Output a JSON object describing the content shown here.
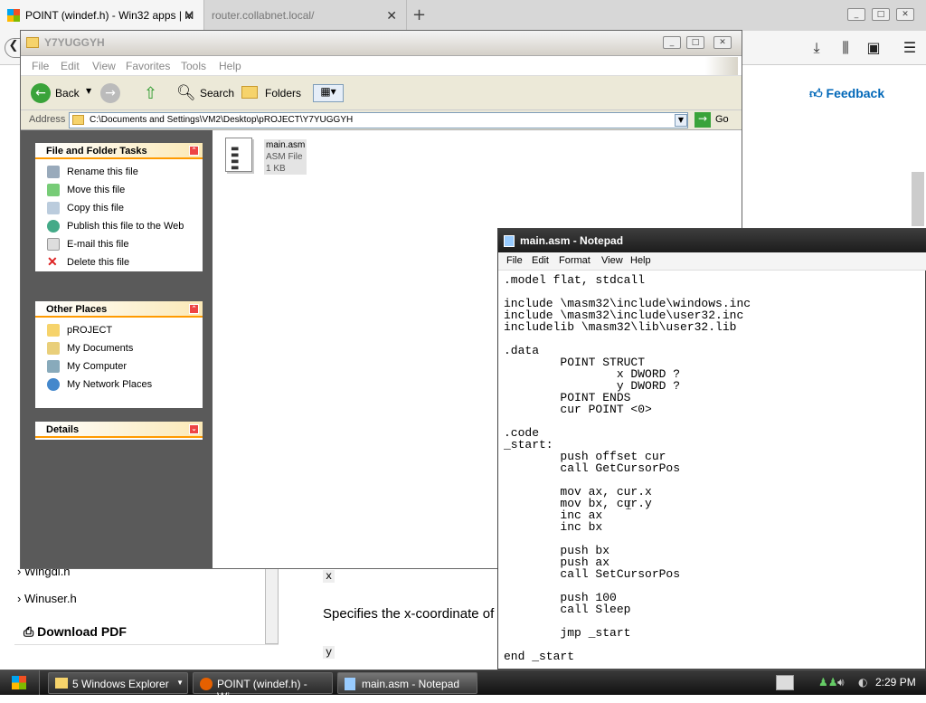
{
  "browser": {
    "tabs": [
      {
        "label": "POINT (windef.h) - Win32 apps | M"
      },
      {
        "label": "router.collabnet.local/"
      }
    ],
    "new_tab": "+",
    "page": {
      "feedback": "Feedback",
      "toc": [
        "Wingdi.h",
        "Winuser.h"
      ],
      "download": "Download PDF",
      "params": [
        "x",
        "y"
      ],
      "description": "Specifies the x-coordinate of"
    }
  },
  "explorer": {
    "title": "Y7YUGGYH",
    "menu": [
      "File",
      "Edit",
      "View",
      "Favorites",
      "Tools",
      "Help"
    ],
    "toolbar": {
      "back": "Back",
      "search": "Search",
      "folders": "Folders"
    },
    "address": {
      "label": "Address",
      "value": "C:\\Documents and Settings\\VM2\\Desktop\\pROJECT\\Y7YUGGYH",
      "go": "Go"
    },
    "tasks": {
      "title": "File and Folder Tasks",
      "items": [
        "Rename this file",
        "Move this file",
        "Copy this file",
        "Publish this file to the Web",
        "E-mail this file",
        "Delete this file"
      ]
    },
    "places": {
      "title": "Other Places",
      "items": [
        "pROJECT",
        "My Documents",
        "My Computer",
        "My Network Places"
      ]
    },
    "details": {
      "title": "Details"
    },
    "file": {
      "name": "main.asm",
      "type": "ASM File",
      "size": "1 KB"
    }
  },
  "notepad": {
    "title": "main.asm - Notepad",
    "menu": [
      "File",
      "Edit",
      "Format",
      "View",
      "Help"
    ],
    "content": ".model flat, stdcall\n\ninclude \\masm32\\include\\windows.inc\ninclude \\masm32\\include\\user32.inc\nincludelib \\masm32\\lib\\user32.lib\n\n.data\n        POINT STRUCT\n                x DWORD ?\n                y DWORD ?\n        POINT ENDS\n        cur POINT <0>\n\n.code\n_start:\n        push offset cur\n        call GetCursorPos\n\n        mov ax, cur.x\n        mov bx, cur.y\n        inc ax\n        inc bx\n\n        push bx\n        push ax\n        call SetCursorPos\n\n        push 100\n        call Sleep\n\n        jmp _start\n\nend _start"
  },
  "taskbar": {
    "items": [
      "5 Windows Explorer",
      "POINT (windef.h) - Wi...",
      "main.asm - Notepad"
    ],
    "clock": "2:29 PM"
  }
}
